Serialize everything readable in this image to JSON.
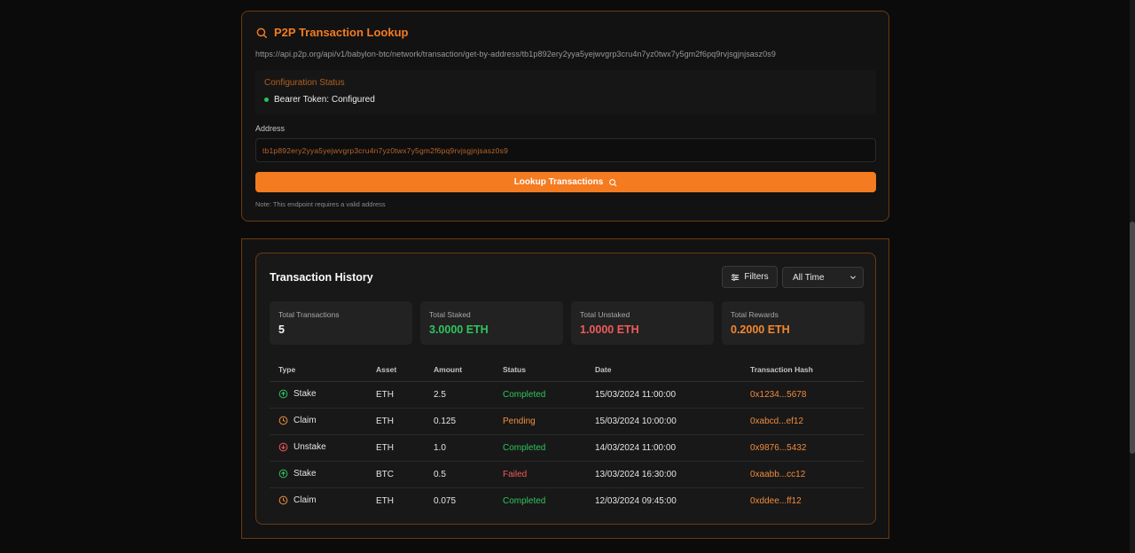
{
  "lookup": {
    "title": "P2P Transaction Lookup",
    "endpoint": "https://api.p2p.org/api/v1/babylon-btc/network/transaction/get-by-address/tb1p892ery2yya5yejwvgrp3cru4n7yz0twx7y5gm2f6pq9rvjsgjnjsasz0s9",
    "config_title": "Configuration Status",
    "config_status": "Bearer Token: Configured",
    "address_label": "Address",
    "address_value": "tb1p892ery2yya5yejwvgrp3cru4n7yz0twx7y5gm2f6pq9rvjsgjnjsasz0s9",
    "button_label": "Lookup Transactions",
    "note": "Note: This endpoint requires a valid address"
  },
  "history": {
    "title": "Transaction History",
    "filters_label": "Filters",
    "time_filter": "All Time",
    "stats": [
      {
        "label": "Total Transactions",
        "value": "5",
        "color": "#f5f5f5"
      },
      {
        "label": "Total Staked",
        "value": "3.0000 ETH",
        "color": "#2fc45f"
      },
      {
        "label": "Total Unstaked",
        "value": "1.0000 ETH",
        "color": "#ef5b5b"
      },
      {
        "label": "Total Rewards",
        "value": "0.2000 ETH",
        "color": "#f5872f"
      }
    ],
    "columns": [
      "Type",
      "Asset",
      "Amount",
      "Status",
      "Date",
      "Transaction Hash"
    ],
    "rows": [
      {
        "type": "Stake",
        "icon": "arrow-up-circle-icon",
        "asset": "ETH",
        "amount": "2.5",
        "status": "Completed",
        "date": "15/03/2024 11:00:00",
        "hash": "0x1234...5678"
      },
      {
        "type": "Claim",
        "icon": "clock-icon",
        "asset": "ETH",
        "amount": "0.125",
        "status": "Pending",
        "date": "15/03/2024 10:00:00",
        "hash": "0xabcd...ef12"
      },
      {
        "type": "Unstake",
        "icon": "arrow-down-circle-icon",
        "asset": "ETH",
        "amount": "1.0",
        "status": "Completed",
        "date": "14/03/2024 11:00:00",
        "hash": "0x9876...5432"
      },
      {
        "type": "Stake",
        "icon": "arrow-up-circle-icon",
        "asset": "BTC",
        "amount": "0.5",
        "status": "Failed",
        "date": "13/03/2024 16:30:00",
        "hash": "0xaabb...cc12"
      },
      {
        "type": "Claim",
        "icon": "clock-icon",
        "asset": "ETH",
        "amount": "0.075",
        "status": "Completed",
        "date": "12/03/2024 09:45:00",
        "hash": "0xddee...ff12"
      }
    ]
  },
  "colors": {
    "accent": "#f47b20",
    "success": "#2fc45f",
    "pending": "#f0913c",
    "failed": "#ef5b5b"
  }
}
